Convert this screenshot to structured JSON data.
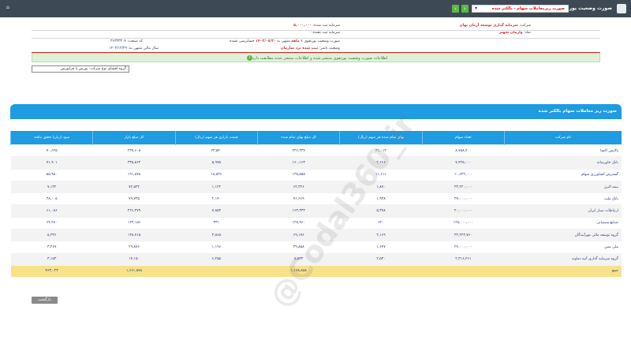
{
  "topbar": {
    "title": "صورت وضعیت پورتفوی",
    "report_select": "صورت ریزمعاملات سهام - بالکتر شده",
    "home_label": "⌂"
  },
  "info": {
    "company_label": "شرکت:",
    "company_value": "سرمایه گذاری توسعه آرمان بهان",
    "symbol_label": "نماد:",
    "symbol_value": "وآرمان تجهیز",
    "code_label": "کد صنعت:",
    "code_value": "۳۶۳۳۳۳۰۴",
    "fiscal_label": "سال مالی منتهی به:",
    "fiscal_value": "۱۴۰۳/۱۲/۲۹",
    "capital_label": "سرمایه ثبت شده:",
    "capital_value": "۵,۰۰۰,۰۰۰",
    "unregistered_label": "سرمایه ثبت نشده:",
    "unregistered_value": "۰",
    "period_label": "دوره:",
    "period_value": "۱ ماهه",
    "ending_label": "منتهی به",
    "ending_value": "۱۴۰۳/۰۸/۳۰",
    "audit_label": "حسابرسی نشده",
    "status_label": "وضعیت ناشر:",
    "status_value": "ثبت شده نزد سازمان",
    "portfolio_label": "صورت وضعیت پورتفوی"
  },
  "alert": "اطلاعات صورت وضعیت پورتفوی منتشر شده و اطلاعات منتشر شده مطابقت دارد",
  "filter": "گروه افشای نوع شرکت: بورس یا فرابورس",
  "panel_title": "صورت ریز معاملات سهام بالکتر شده",
  "table": {
    "headers": [
      "نام شرکت",
      "تعداد سهام",
      "بهای تمام شده هر سهم (ریال)",
      "کل مبلغ بهای تمام شده",
      "قیمت بازاری هر سهم (ریال)",
      "کل مبلغ بازار",
      "سود (زیان) تحقق نیافته"
    ],
    "rows": [
      [
        "پالایش اکسا",
        "۸,۷۵۸,۴۰۰",
        "۲۱,۰۱۲",
        "۲۳۶,۳۳۴",
        "۲۳,۵۴۰",
        "۲۳۷,۶۰۸",
        "۷۰,۶۲۵"
      ],
      [
        "بانک خاورمیانه",
        "۷,۴۲۵,۰۰۰",
        "۲,۶۶۶",
        "۱۶۰,۱۶۳",
        "۵,۹۷۵",
        "۳۳۵,۵۶۳",
        "۷۱,۹۰۱"
      ],
      [
        "گسترش کشاورزی سهام",
        "۱۰,۶۲۲,۰۰۰",
        "۱۱,۶۱۱",
        "۱۳۸,۵۵۵",
        "۱۸,۵۳۶",
        "۱۹۱,۸۷۸",
        "۵۵,۹۵۰"
      ],
      [
        "بیمه البرز",
        "۳۳,۲۲۰,۰۰۰",
        "۱,۸۷۰",
        "۶۲,۳۲۶",
        "۱,۱۲۲",
        "۷۲,۵۳۲",
        "۷,۱۲۲"
      ],
      [
        "بانک ملت",
        "۳۷,۰۰۰,۰۰۰",
        "۱,۹۳۸",
        "۷۱,۶۶۹",
        "۲,۱۴۰",
        "۷۹,۷۳۵",
        "۳۸,۰۰۵"
      ],
      [
        "ارتباطات سیار ایران",
        "۲۰,۰۰۰,۰۰۰",
        "۵,۳۷۸",
        "۱۶۳,۳۳۳",
        "۷,۸۵۳",
        "۲۲۶,۳۷۹",
        "۶۱,۰۸۶"
      ],
      [
        "صنایع شیمیایی",
        "۱۲۸,۰۰۰,۰۰۰",
        "۶۲۰",
        "۱۲۸,۹۶۰",
        "۳۳۱",
        "۱۲۳,۱۵۶",
        "۶۴,۲۸۰"
      ],
      [
        "گروه توسعه مالی مهرآیندگان",
        "۳۲,۲۲۳,۷۶۰",
        "۲,۱۶۹",
        "۶۹,۱۷۶",
        "۳,۵۶۵",
        "۱۳۸,۷۱۵",
        "۵,۳۳۶"
      ],
      [
        "ملی مس",
        "۲۴,۰۰۰,۰۰۰",
        "۱,۶۴۷",
        "۳۹,۸۵۸",
        "۱,۱۹۶",
        "۲۹,۸۷۶",
        "۳,۳۶۹"
      ],
      [
        "گروه سرمایه گذاری آتیه دماوند",
        "۲,۳۱۶,۲۶۱",
        "۲,۵۳۰",
        "۵,۸۳۳",
        "۶,۲۵۵",
        "۱۴,۱۵۰",
        "۳,۱۵۳"
      ]
    ],
    "total_label": "جمع",
    "total_cost": "۱,۱۷۸,۸۸۸",
    "total_market": "۱,۶۶۱,۸۷۸",
    "total_profit": "۴۶۳,۰۲۳"
  },
  "back_button": "بازگشت",
  "watermark": "@Codal360_ir"
}
